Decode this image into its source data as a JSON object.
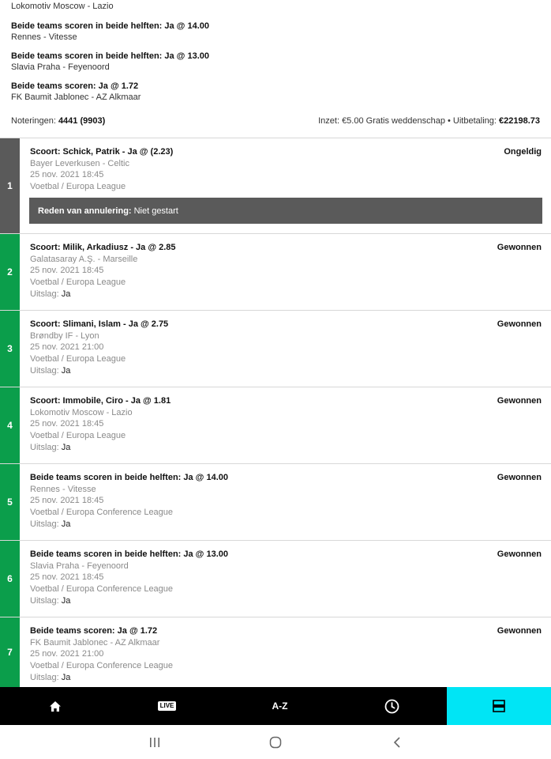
{
  "summary": {
    "top_match": "Lokomotiv Moscow - Lazio",
    "selections": [
      {
        "title": "Beide teams scoren in beide helften: Ja @ 14.00",
        "match": "Rennes - Vitesse"
      },
      {
        "title": "Beide teams scoren in beide helften: Ja @ 13.00",
        "match": "Slavia Praha - Feyenoord"
      },
      {
        "title": "Beide teams scoren: Ja @ 1.72",
        "match": "FK Baumit Jablonec - AZ Alkmaar"
      }
    ],
    "noteringen_label": "Noteringen:",
    "noteringen_value": "4441 (9903)",
    "inzet_text": "Inzet: €5.00 Gratis weddenschap • Uitbetaling:",
    "uitbetaling_value": "€22198.73"
  },
  "legs": [
    {
      "num": "1",
      "title": "Scoort: Schick, Patrik - Ja @ (2.23)",
      "match": "Bayer Leverkusen - Celtic",
      "date": "25 nov. 2021 18:45",
      "league": "Voetbal / Europa League",
      "status": "Ongeldig",
      "cancel_label": "Reden van annulering:",
      "cancel_value": "Niet gestart"
    },
    {
      "num": "2",
      "title": "Scoort: Milik, Arkadiusz - Ja @ 2.85",
      "match": "Galatasaray A.Ş. - Marseille",
      "date": "25 nov. 2021 18:45",
      "league": "Voetbal / Europa League",
      "status": "Gewonnen",
      "result_label": "Uitslag:",
      "result_value": "Ja"
    },
    {
      "num": "3",
      "title": "Scoort: Slimani, Islam - Ja @ 2.75",
      "match": "Brøndby IF - Lyon",
      "date": "25 nov. 2021 21:00",
      "league": "Voetbal / Europa League",
      "status": "Gewonnen",
      "result_label": "Uitslag:",
      "result_value": "Ja"
    },
    {
      "num": "4",
      "title": "Scoort: Immobile, Ciro - Ja @ 1.81",
      "match": "Lokomotiv Moscow - Lazio",
      "date": "25 nov. 2021 18:45",
      "league": "Voetbal / Europa League",
      "status": "Gewonnen",
      "result_label": "Uitslag:",
      "result_value": "Ja"
    },
    {
      "num": "5",
      "title": "Beide teams scoren in beide helften: Ja @ 14.00",
      "match": "Rennes - Vitesse",
      "date": "25 nov. 2021 18:45",
      "league": "Voetbal / Europa Conference League",
      "status": "Gewonnen",
      "result_label": "Uitslag:",
      "result_value": "Ja"
    },
    {
      "num": "6",
      "title": "Beide teams scoren in beide helften: Ja @ 13.00",
      "match": "Slavia Praha - Feyenoord",
      "date": "25 nov. 2021 18:45",
      "league": "Voetbal / Europa Conference League",
      "status": "Gewonnen",
      "result_label": "Uitslag:",
      "result_value": "Ja"
    },
    {
      "num": "7",
      "title": "Beide teams scoren: Ja @ 1.72",
      "match": "FK Baumit Jablonec - AZ Alkmaar",
      "date": "25 nov. 2021 21:00",
      "league": "Voetbal / Europa Conference League",
      "status": "Gewonnen",
      "result_label": "Uitslag:",
      "result_value": "Ja"
    }
  ],
  "nav": {
    "live_label": "LIVE",
    "az_label": "A-Z",
    "icons": [
      "home-icon",
      "live-icon",
      "a-z-icon",
      "clock-icon",
      "betslip-icon"
    ]
  },
  "colors": {
    "won": "#0b9e4b",
    "void": "#5a5a5a",
    "active_tab": "#00e5f5"
  }
}
